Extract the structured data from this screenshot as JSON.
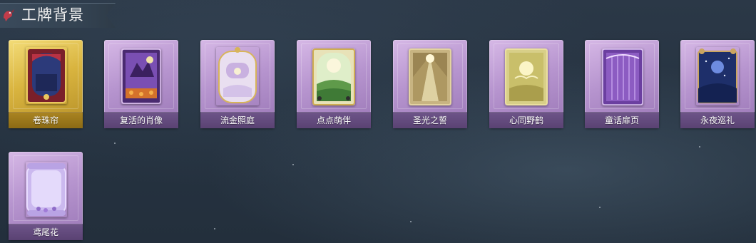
{
  "header": {
    "title": "工牌背景",
    "emblem_icon": "red-bird-emblem-icon"
  },
  "colors": {
    "background": "#263341",
    "card_purple": "#b795cf",
    "card_gold": "#d9b43f",
    "label_text": "#ffffff"
  },
  "cards": [
    {
      "label": "卷珠帘",
      "rarity": "gold",
      "art_icon": "curtain-portrait-art"
    },
    {
      "label": "复活的肖像",
      "rarity": "purple",
      "art_icon": "haunted-portrait-art"
    },
    {
      "label": "流金照庭",
      "rarity": "purple",
      "art_icon": "golden-courtyard-art"
    },
    {
      "label": "点点萌伴",
      "rarity": "purple",
      "art_icon": "green-meadow-art"
    },
    {
      "label": "圣光之誓",
      "rarity": "purple",
      "art_icon": "holy-light-art"
    },
    {
      "label": "心同野鹤",
      "rarity": "purple",
      "art_icon": "wild-crane-art"
    },
    {
      "label": "童话扉页",
      "rarity": "purple",
      "art_icon": "fairytale-page-art"
    },
    {
      "label": "永夜巡礼",
      "rarity": "purple",
      "art_icon": "eternal-night-art"
    },
    {
      "label": "鸢尾花",
      "rarity": "purple",
      "art_icon": "iris-flower-art"
    }
  ]
}
